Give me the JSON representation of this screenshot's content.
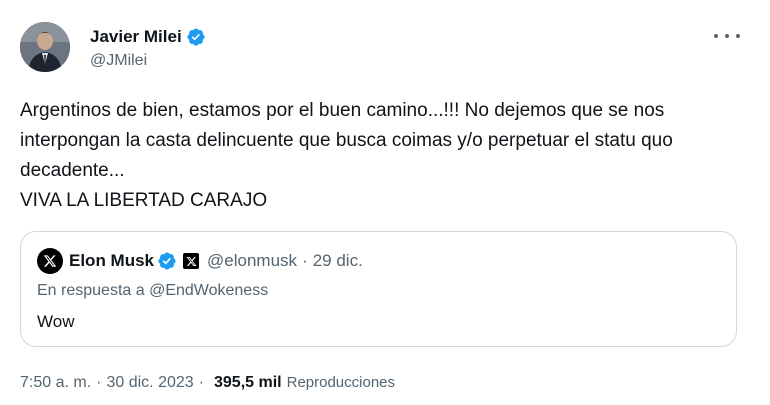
{
  "author": {
    "display_name": "Javier Milei",
    "handle": "@JMilei",
    "verified": true
  },
  "tweet": {
    "text": "Argentinos de bien, estamos por el buen camino...!!! No dejemos que se nos interpongan la casta delincuente que busca coimas y/o perpetuar el statu quo decadente...\nVIVA LA LIBERTAD CARAJO"
  },
  "quoted": {
    "display_name": "Elon Musk",
    "handle": "@elonmusk",
    "date": "29 dic.",
    "reply_prefix": "En respuesta a",
    "reply_to": "@EndWokeness",
    "text": "Wow"
  },
  "footer": {
    "time": "7:50 a. m.",
    "date": "30 dic. 2023",
    "views_count": "395,5 mil",
    "views_label": "Reproducciones"
  },
  "colors": {
    "verified_blue": "#1d9bf0",
    "secondary_text": "#536471",
    "border": "#cfd9de"
  }
}
